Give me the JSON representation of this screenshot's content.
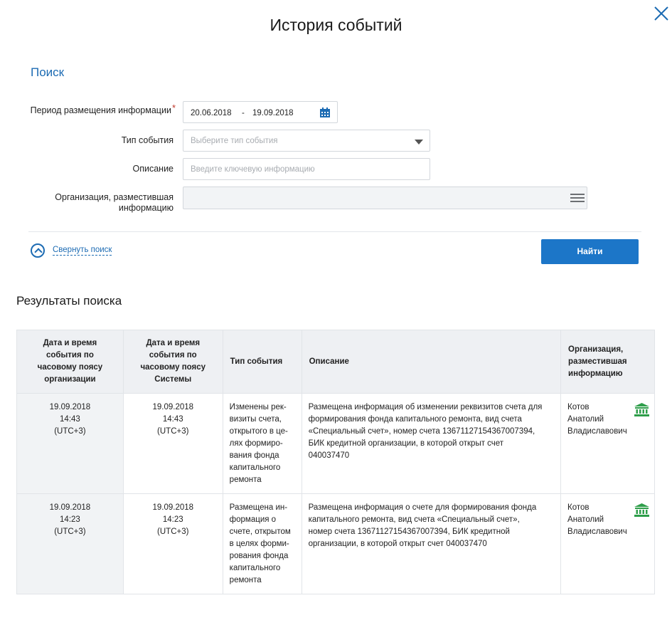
{
  "modal": {
    "title": "История событий",
    "close_icon": "close-icon"
  },
  "search": {
    "heading": "Поиск",
    "period_label": "Период размещения информации",
    "required_mark": "*",
    "date_from": "20.06.2018",
    "date_sep": "-",
    "date_to": "19.09.2018",
    "event_type_label": "Тип события",
    "event_type_placeholder": "Выберите тип события",
    "description_label": "Описание",
    "description_placeholder": "Введите ключевую информацию",
    "org_label_line1": "Организация, разместившая",
    "org_label_line2": "информацию",
    "org_value": "",
    "collapse_label": "Свернуть поиск",
    "find_button": "Найти"
  },
  "results": {
    "heading": "Результаты поиска",
    "columns": [
      [
        "Дата и время",
        "события по",
        "часовому поясу",
        "организации"
      ],
      [
        "Дата и время",
        "события по",
        "часовому поясу",
        "Системы"
      ],
      [
        "Тип события"
      ],
      [
        "Описание"
      ],
      [
        "Организация,",
        "разместившая",
        "информацию"
      ]
    ],
    "rows": [
      {
        "org_date": [
          "19.09.2018",
          "14:43",
          "(UTC+3)"
        ],
        "sys_date": [
          "19.09.2018",
          "14:43",
          "(UTC+3)"
        ],
        "type": [
          "Изменены рек-",
          "визиты счета,",
          "открытого в це-",
          "лях формиро-",
          "вания фонда",
          "капитального",
          "ремонта"
        ],
        "description": [
          "Размещена информация об изменении реквизитов счета для",
          "формирования фонда капитального ремонта, вид счета",
          "«Специальный счет», номер счета 13671127154367007394,",
          "БИК кредитной организации, в которой открыт счет",
          "040037470"
        ],
        "org": [
          "Котов",
          "Анатолий",
          "Владиславович"
        ]
      },
      {
        "org_date": [
          "19.09.2018",
          "14:23",
          "(UTC+3)"
        ],
        "sys_date": [
          "19.09.2018",
          "14:23",
          "(UTC+3)"
        ],
        "type": [
          "Размещена ин-",
          "формация о",
          "счете, открытом",
          "в целях форми-",
          "рования фонда",
          "капитального",
          "ремонта"
        ],
        "description": [
          "Размещена информация о счете для формирования фонда",
          "капитального ремонта, вид счета «Специальный счет»,",
          "номер счета 13671127154367007394, БИК кредитной",
          "организации, в которой открыт счет 040037470"
        ],
        "org": [
          "Котов",
          "Анатолий",
          "Владиславович"
        ]
      }
    ]
  },
  "colors": {
    "accent": "#1c6bb3",
    "button": "#1c76c8",
    "bank_icon": "#2e9e4a"
  }
}
